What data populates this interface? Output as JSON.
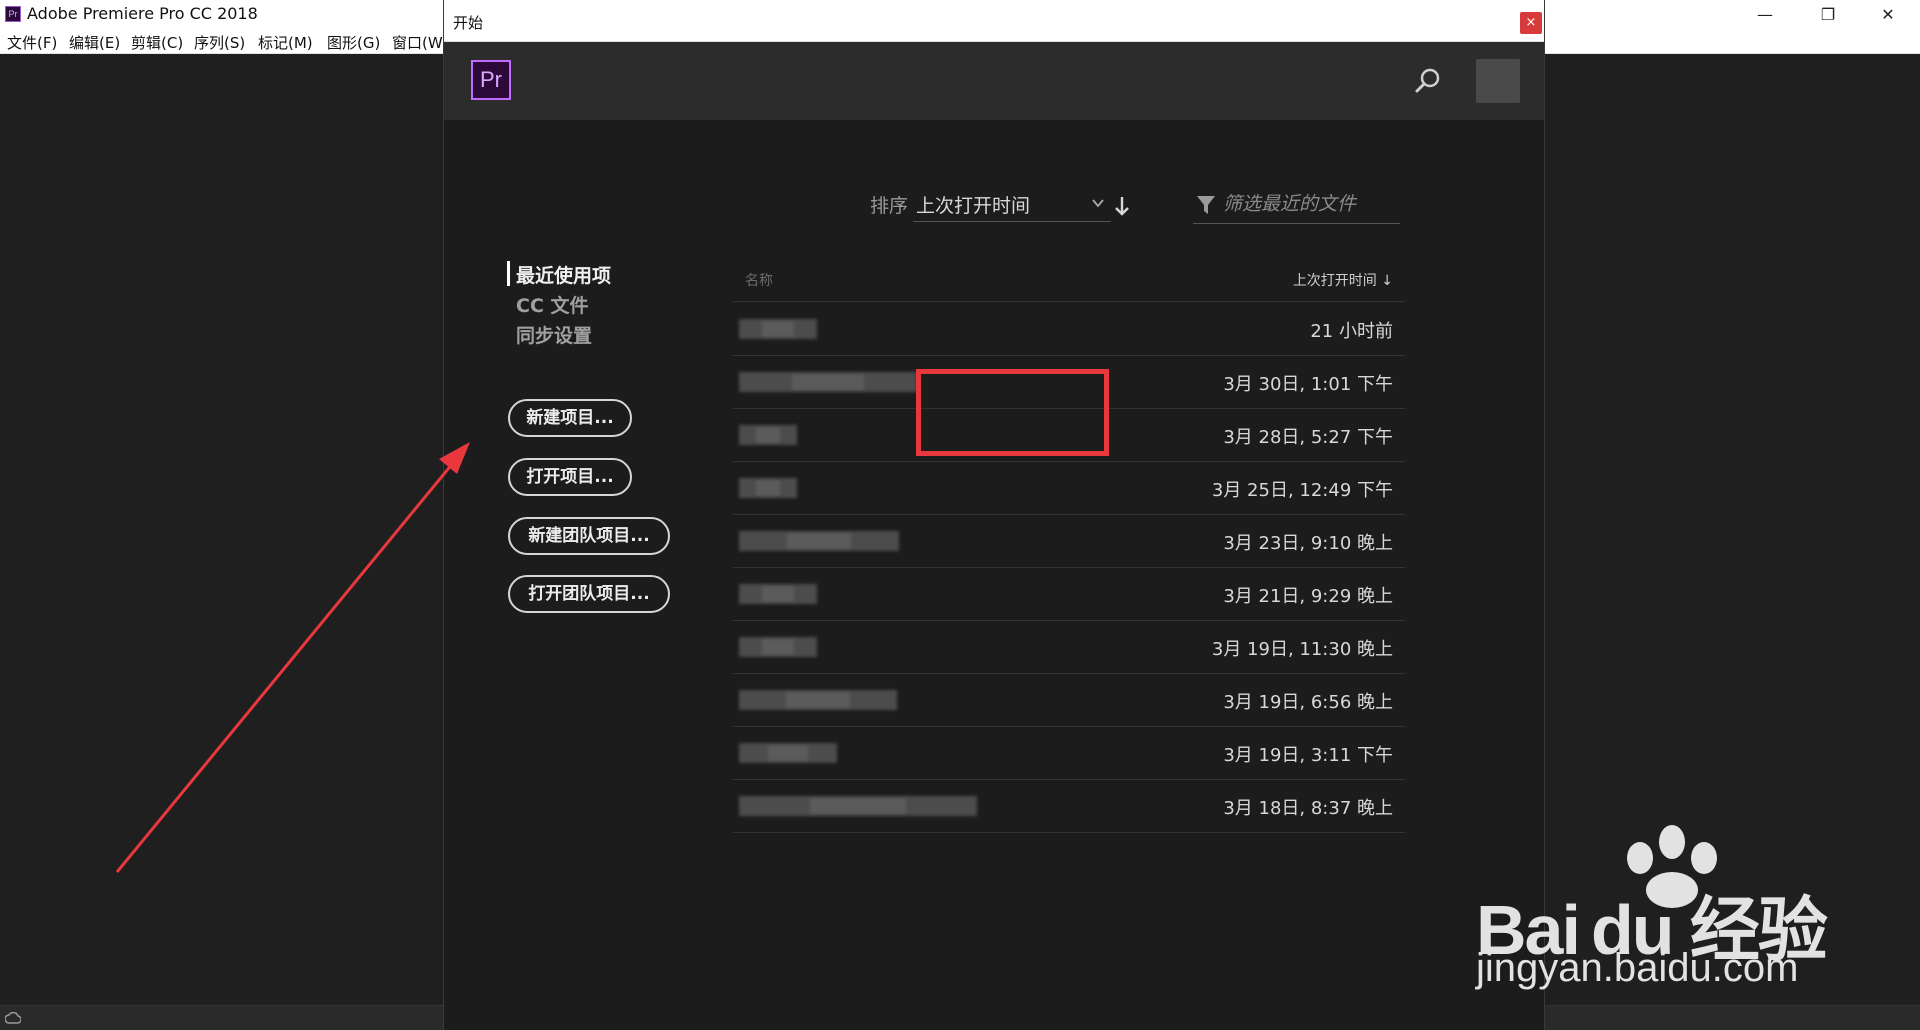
{
  "app": {
    "title": "Adobe Premiere Pro CC 2018",
    "logo_text": "Pr",
    "window_controls": [
      "—",
      "❐",
      "✕"
    ],
    "menu": [
      "文件(F)",
      "编辑(E)",
      "剪辑(C)",
      "序列(S)",
      "标记(M)",
      "图形(G)",
      "窗口(W)"
    ]
  },
  "dialog": {
    "title": "开始",
    "close_label": "×",
    "logo_text": "Pr",
    "sort_label": "排序",
    "sort_value": "上次打开时间",
    "filter_placeholder": "筛选最近的文件",
    "nav": [
      "最近使用项",
      "CC 文件",
      "同步设置"
    ],
    "buttons": {
      "new_project": "新建项目...",
      "open_project": "打开项目...",
      "new_team_project": "新建团队项目...",
      "open_team_project": "打开团队项目..."
    },
    "table": {
      "col_name": "名称",
      "col_date": "上次打开时间 ↓",
      "rows": [
        "21 小时前",
        "3月 30日, 1:01 下午",
        "3月 28日, 5:27 下午",
        "3月 25日, 12:49 下午",
        "3月 23日, 9:10 晚上",
        "3月 21日, 9:29 晚上",
        "3月 19日, 11:30 晚上",
        "3月 19日, 6:56 晚上",
        "3月 19日, 3:11 下午",
        "3月 18日, 8:37 晚上"
      ]
    }
  },
  "watermark": {
    "brand": "Bai du 经验",
    "url": "jingyan.baidu.com"
  },
  "colors": {
    "accent_purple": "#c16bff",
    "highlight_red": "#e8383d",
    "close_red": "#d83b3b"
  }
}
